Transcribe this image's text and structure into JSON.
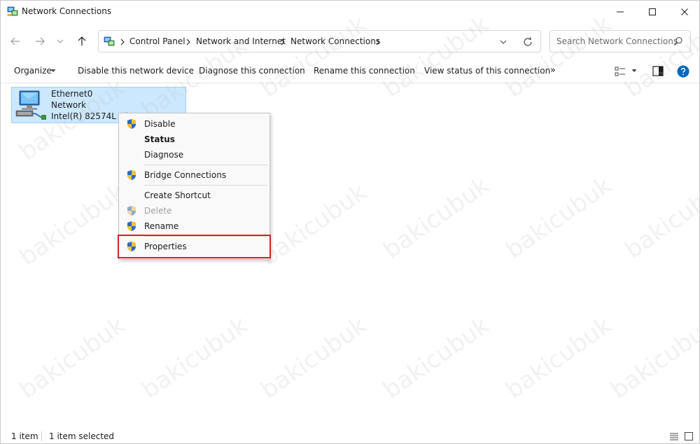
{
  "window": {
    "title": "Network Connections"
  },
  "address_bar": {
    "breadcrumbs": [
      "Control Panel",
      "Network and Internet",
      "Network Connections"
    ]
  },
  "search": {
    "placeholder": "Search Network Connections"
  },
  "command_bar": {
    "organize": "Organize",
    "disable": "Disable this network device",
    "diagnose": "Diagnose this connection",
    "rename": "Rename this connection",
    "view_status": "View status of this connection",
    "more": "»"
  },
  "connection": {
    "name": "Ethernet0",
    "network": "Network",
    "adapter": "Intel(R) 82574L Gig"
  },
  "context_menu": {
    "items": [
      {
        "label": "Disable"
      },
      {
        "label": "Status"
      },
      {
        "label": "Diagnose"
      },
      {
        "label": "Bridge Connections"
      },
      {
        "label": "Create Shortcut"
      },
      {
        "label": "Delete"
      },
      {
        "label": "Rename"
      },
      {
        "label": "Properties"
      }
    ]
  },
  "status_bar": {
    "count": "1 item",
    "selected": "1 item selected"
  },
  "watermark": "bakicubuk",
  "colors": {
    "selection": "#cce8ff",
    "selection_border": "#99d1ff",
    "highlight_box": "#d4202a",
    "help": "#0067c0"
  }
}
